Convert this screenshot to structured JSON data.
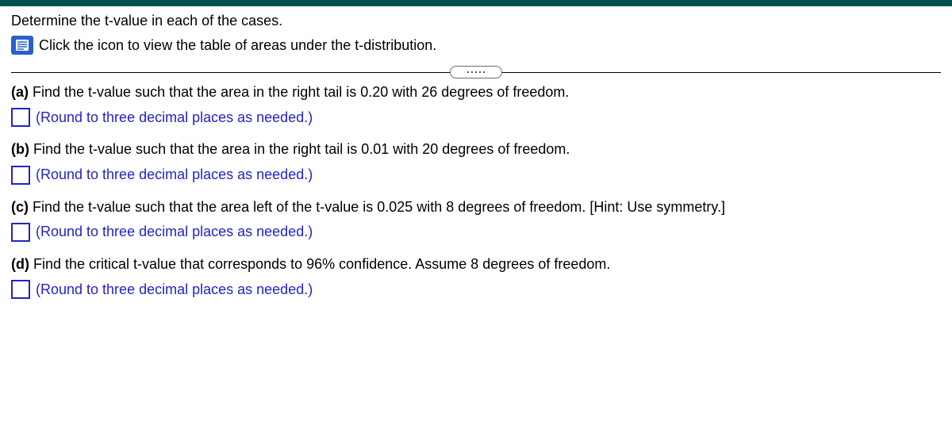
{
  "header": {
    "instruction": "Determine the t-value in each of the cases.",
    "icon_text": "Click the icon to view the table of areas under the t-distribution."
  },
  "questions": {
    "a": {
      "label": "(a)",
      "text": " Find the t-value such that the area in the right tail is 0.20 with 26 degrees of freedom.",
      "hint": "(Round to three decimal places as needed.)",
      "value": ""
    },
    "b": {
      "label": "(b)",
      "text": " Find the t-value such that the area in the right tail is 0.01 with 20 degrees of freedom.",
      "hint": "(Round to three decimal places as needed.)",
      "value": ""
    },
    "c": {
      "label": "(c)",
      "text": " Find the t-value such that the area left of the t-value is 0.025 with 8 degrees of freedom. [Hint: Use symmetry.]",
      "hint": "(Round to three decimal places as needed.)",
      "value": ""
    },
    "d": {
      "label": "(d)",
      "text": " Find the critical t-value that corresponds to 96% confidence. Assume 8 degrees of freedom.",
      "hint": "(Round to three decimal places as needed.)",
      "value": ""
    }
  }
}
